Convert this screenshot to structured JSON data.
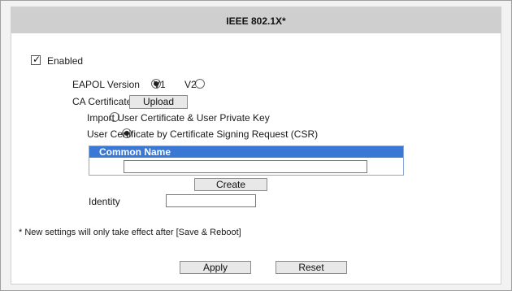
{
  "header": {
    "title": "IEEE 802.1X*"
  },
  "enabled": {
    "label": "Enabled",
    "checked": true
  },
  "eapol": {
    "label": "EAPOL Version",
    "options": [
      {
        "label": "V1",
        "checked": true
      },
      {
        "label": "V2",
        "checked": false
      }
    ]
  },
  "ca_certificate": {
    "label": "CA Certificate",
    "button_label": "Upload"
  },
  "cert_options": [
    {
      "label": "Import User Certificate & User Private Key",
      "checked": false
    },
    {
      "label": "User Certificate by Certificate Signing Request (CSR)",
      "checked": true
    }
  ],
  "csr_table": {
    "header": "Common Name",
    "value": "",
    "create_label": "Create"
  },
  "identity": {
    "label": "Identity",
    "value": ""
  },
  "note": "* New settings will only take effect after [Save & Reboot]",
  "actions": {
    "apply_label": "Apply",
    "reset_label": "Reset"
  }
}
